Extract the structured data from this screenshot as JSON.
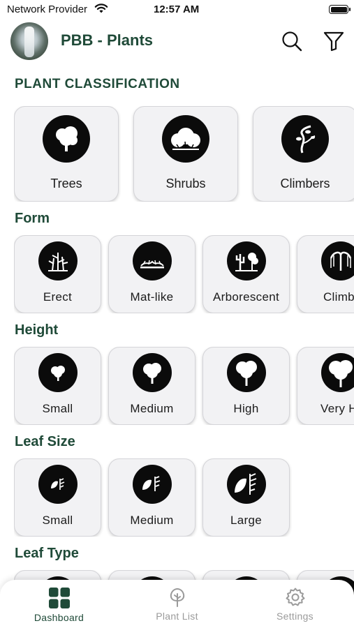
{
  "status_bar": {
    "carrier": "Network Provider",
    "time": "12:57 AM",
    "icons": [
      "wifi-icon",
      "battery-icon"
    ]
  },
  "header": {
    "title": "PBB - Plants",
    "avatar_icon": "waterfall-avatar",
    "actions": [
      "search-icon",
      "filter-icon"
    ]
  },
  "colors": {
    "accent": "#1f4a38",
    "card_bg": "#f2f2f4",
    "icon_disc": "#0b0b0b",
    "inactive": "#9a9a9a"
  },
  "classification": {
    "title": "PLANT CLASSIFICATION",
    "items": [
      {
        "label": "Trees",
        "icon": "tree-icon"
      },
      {
        "label": "Shrubs",
        "icon": "shrub-icon"
      },
      {
        "label": "Climbers",
        "icon": "climber-icon"
      }
    ]
  },
  "form": {
    "title": "Form",
    "items": [
      {
        "label": "Erect",
        "icon": "erect-plant-icon"
      },
      {
        "label": "Mat-like",
        "icon": "mat-plant-icon"
      },
      {
        "label": "Arborescent",
        "icon": "arborescent-icon"
      },
      {
        "label": "Climbi",
        "icon": "climbing-plant-icon"
      }
    ]
  },
  "height": {
    "title": "Height",
    "items": [
      {
        "label": "Small",
        "icon": "small-tree-icon"
      },
      {
        "label": "Medium",
        "icon": "medium-tree-icon"
      },
      {
        "label": "High",
        "icon": "high-tree-icon"
      },
      {
        "label": "Very Hi",
        "icon": "very-high-tree-icon"
      }
    ]
  },
  "leaf_size": {
    "title": "Leaf Size",
    "items": [
      {
        "label": "Small",
        "icon": "small-leaf-icon"
      },
      {
        "label": "Medium",
        "icon": "medium-leaf-icon"
      },
      {
        "label": "Large",
        "icon": "large-leaf-icon"
      }
    ]
  },
  "leaf_type": {
    "title": "Leaf Type"
  },
  "bottom_nav": {
    "items": [
      {
        "label": "Dashboard",
        "icon": "dashboard-icon",
        "active": true
      },
      {
        "label": "Plant List",
        "icon": "plant-list-icon",
        "active": false
      },
      {
        "label": "Settings",
        "icon": "settings-icon",
        "active": false
      }
    ]
  }
}
